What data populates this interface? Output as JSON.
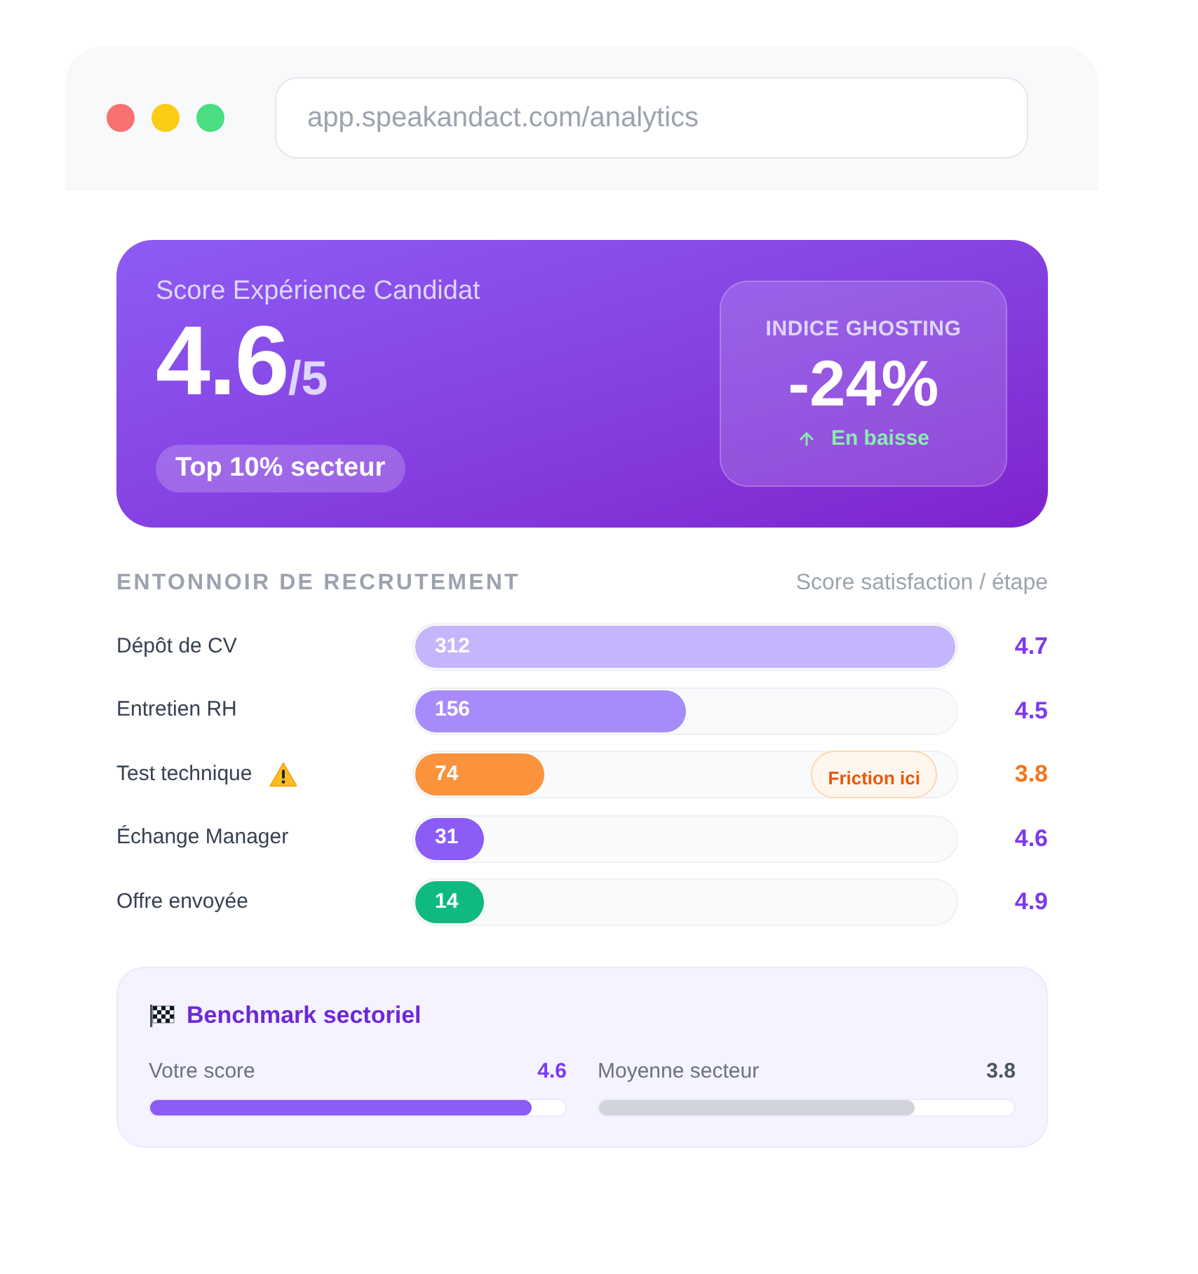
{
  "browser": {
    "url": "app.speakandact.com/analytics"
  },
  "hero": {
    "title": "Score Expérience Candidat",
    "score": "4.6",
    "scale": "/5",
    "badge": "Top 10% secteur",
    "ghosting": {
      "label": "INDICE GHOSTING",
      "value": "-24%",
      "trend": "En baisse"
    }
  },
  "funnel": {
    "title": "ENTONNOIR DE RECRUTEMENT",
    "subtitle": "Score satisfaction / étape",
    "stages": [
      {
        "label": "Dépôt de CV",
        "count": "312",
        "level": 1,
        "color": "#c4b5fd",
        "score": "4.7",
        "warning": false
      },
      {
        "label": "Entretien RH",
        "count": "156",
        "level": 0.5,
        "color": "#a78bfa",
        "score": "4.5",
        "warning": false
      },
      {
        "label": "Test technique",
        "count": "74",
        "level": 0.24,
        "color": "#fb923c",
        "score": "3.8",
        "warning": true,
        "callout": "Friction ici"
      },
      {
        "label": "Échange Manager",
        "count": "31",
        "level": 0.126,
        "color": "#8b5cf6",
        "score": "4.6",
        "warning": false
      },
      {
        "label": "Offre envoyée",
        "count": "14",
        "level": 0.126,
        "color": "#10b981",
        "score": "4.9",
        "warning": false
      }
    ]
  },
  "benchmark": {
    "title": "Benchmark sectoriel",
    "items": [
      {
        "label": "Votre score",
        "value": "4.6",
        "level": 0.92,
        "color": "#8b5cf6",
        "kind": "own"
      },
      {
        "label": "Moyenne secteur",
        "value": "3.8",
        "level": 0.76,
        "color": "#d1d5db",
        "kind": "sector"
      }
    ]
  }
}
